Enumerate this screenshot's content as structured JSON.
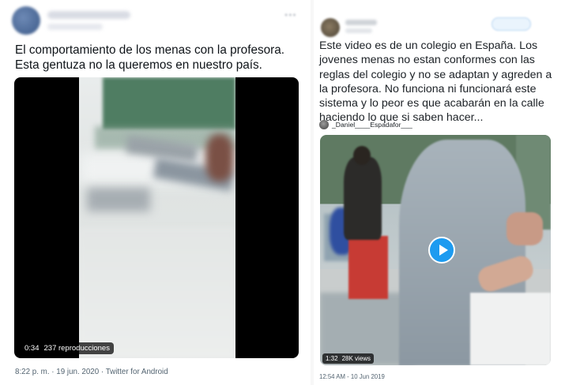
{
  "left_tweet": {
    "text": "El comportamiento de los menas con la profesora. Esta gentuza no la queremos en nuestro país.",
    "video": {
      "duration": "0:34",
      "views": "237 reproducciones"
    },
    "meta": "8:22 p. m. · 19 jun. 2020 · Twitter for Android"
  },
  "right_tweet": {
    "text": "Este video es de un colegio en España. Los jovenes menas no estan conformes con las reglas del colegio y no se adaptan y agreden a la profesora. No funciona ni funcionará este sistema y lo peor es que acabarán en la calle haciendo lo que si saben hacer...",
    "quoted_user": "_Daniel____Espadafor___",
    "video": {
      "duration": "1:32",
      "views": "28K views"
    },
    "meta": "12:54 AM - 10 Jun 2019"
  },
  "colors": {
    "text": "#0f1419",
    "secondary": "#536471",
    "accent": "#1d9bf0"
  },
  "icons": [
    "more-icon",
    "play-icon"
  ]
}
